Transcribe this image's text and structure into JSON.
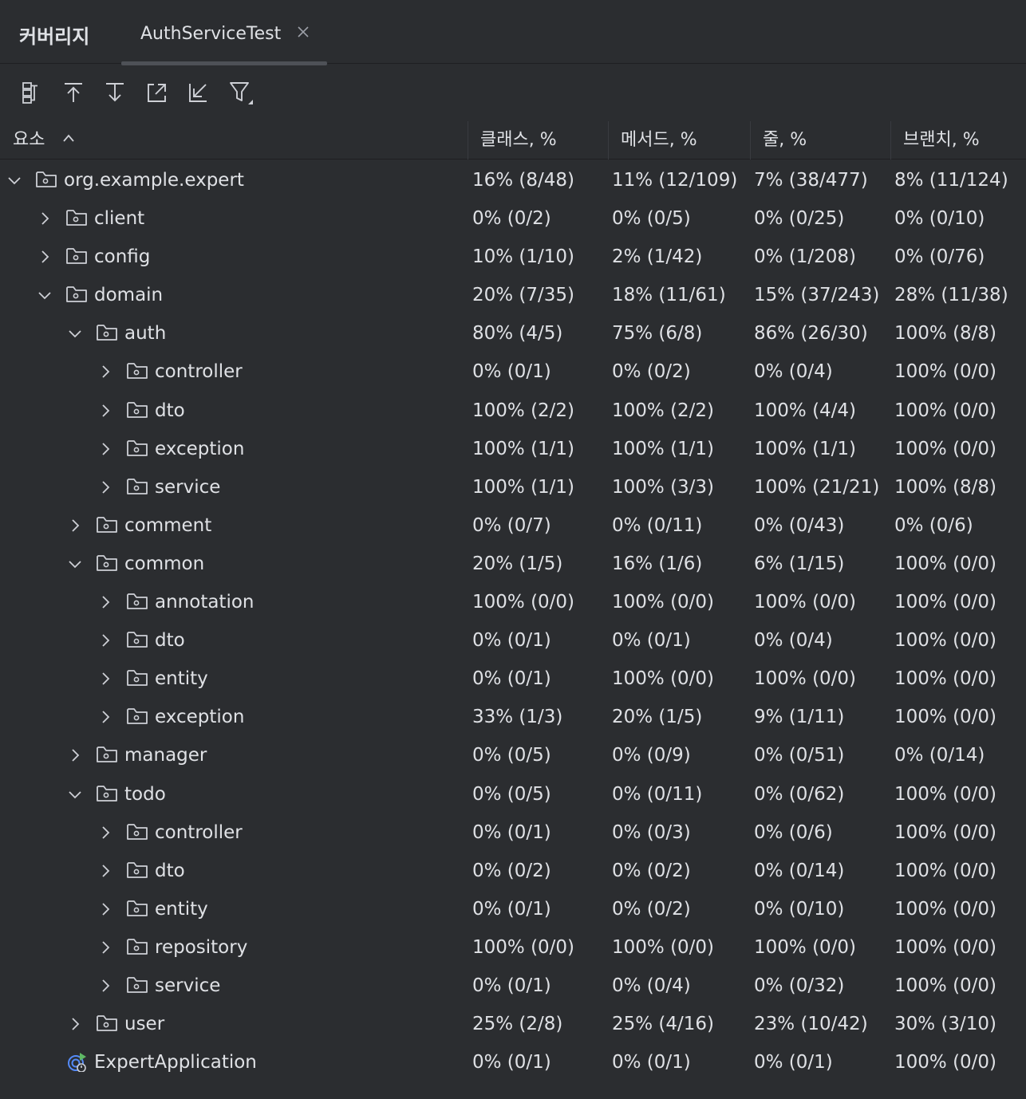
{
  "panel": {
    "title": "커버리지",
    "tab_label": "AuthServiceTest",
    "close_glyph": "×"
  },
  "toolbar": {
    "buttons": [
      "flatten-packages-icon",
      "navigate-up-icon",
      "navigate-down-icon",
      "export-icon",
      "import-icon",
      "filter-icon"
    ]
  },
  "columns": {
    "element": "요소",
    "class": "클래스, %",
    "method": "메서드, %",
    "line": "줄, %",
    "branch": "브랜치, %"
  },
  "colors": {
    "background": "#2b2d30",
    "text": "#dfe1e5",
    "icon": "#ced0d6",
    "app_icon_blue": "#548af7",
    "app_icon_green": "#5fb865"
  },
  "rows": [
    {
      "name": "org.example.expert",
      "level": 0,
      "state": "expanded",
      "icon": "package-folder-icon",
      "cls": "16% (8/48)",
      "met": "11% (12/109)",
      "line": "7% (38/477)",
      "br": "8% (11/124)"
    },
    {
      "name": "client",
      "level": 1,
      "state": "collapsed",
      "icon": "package-folder-icon",
      "cls": "0% (0/2)",
      "met": "0% (0/5)",
      "line": "0% (0/25)",
      "br": "0% (0/10)"
    },
    {
      "name": "config",
      "level": 1,
      "state": "collapsed",
      "icon": "package-folder-icon",
      "cls": "10% (1/10)",
      "met": "2% (1/42)",
      "line": "0% (1/208)",
      "br": "0% (0/76)"
    },
    {
      "name": "domain",
      "level": 1,
      "state": "expanded",
      "icon": "package-folder-icon",
      "cls": "20% (7/35)",
      "met": "18% (11/61)",
      "line": "15% (37/243)",
      "br": "28% (11/38)"
    },
    {
      "name": "auth",
      "level": 2,
      "state": "expanded",
      "icon": "package-folder-icon",
      "cls": "80% (4/5)",
      "met": "75% (6/8)",
      "line": "86% (26/30)",
      "br": "100% (8/8)"
    },
    {
      "name": "controller",
      "level": 3,
      "state": "collapsed",
      "icon": "package-folder-icon",
      "cls": "0% (0/1)",
      "met": "0% (0/2)",
      "line": "0% (0/4)",
      "br": "100% (0/0)"
    },
    {
      "name": "dto",
      "level": 3,
      "state": "collapsed",
      "icon": "package-folder-icon",
      "cls": "100% (2/2)",
      "met": "100% (2/2)",
      "line": "100% (4/4)",
      "br": "100% (0/0)"
    },
    {
      "name": "exception",
      "level": 3,
      "state": "collapsed",
      "icon": "package-folder-icon",
      "cls": "100% (1/1)",
      "met": "100% (1/1)",
      "line": "100% (1/1)",
      "br": "100% (0/0)"
    },
    {
      "name": "service",
      "level": 3,
      "state": "collapsed",
      "icon": "package-folder-icon",
      "cls": "100% (1/1)",
      "met": "100% (3/3)",
      "line": "100% (21/21)",
      "br": "100% (8/8)"
    },
    {
      "name": "comment",
      "level": 2,
      "state": "collapsed",
      "icon": "package-folder-icon",
      "cls": "0% (0/7)",
      "met": "0% (0/11)",
      "line": "0% (0/43)",
      "br": "0% (0/6)"
    },
    {
      "name": "common",
      "level": 2,
      "state": "expanded",
      "icon": "package-folder-icon",
      "cls": "20% (1/5)",
      "met": "16% (1/6)",
      "line": "6% (1/15)",
      "br": "100% (0/0)"
    },
    {
      "name": "annotation",
      "level": 3,
      "state": "collapsed",
      "icon": "package-folder-icon",
      "cls": "100% (0/0)",
      "met": "100% (0/0)",
      "line": "100% (0/0)",
      "br": "100% (0/0)"
    },
    {
      "name": "dto",
      "level": 3,
      "state": "collapsed",
      "icon": "package-folder-icon",
      "cls": "0% (0/1)",
      "met": "0% (0/1)",
      "line": "0% (0/4)",
      "br": "100% (0/0)"
    },
    {
      "name": "entity",
      "level": 3,
      "state": "collapsed",
      "icon": "package-folder-icon",
      "cls": "0% (0/1)",
      "met": "100% (0/0)",
      "line": "100% (0/0)",
      "br": "100% (0/0)"
    },
    {
      "name": "exception",
      "level": 3,
      "state": "collapsed",
      "icon": "package-folder-icon",
      "cls": "33% (1/3)",
      "met": "20% (1/5)",
      "line": "9% (1/11)",
      "br": "100% (0/0)"
    },
    {
      "name": "manager",
      "level": 2,
      "state": "collapsed",
      "icon": "package-folder-icon",
      "cls": "0% (0/5)",
      "met": "0% (0/9)",
      "line": "0% (0/51)",
      "br": "0% (0/14)"
    },
    {
      "name": "todo",
      "level": 2,
      "state": "expanded",
      "icon": "package-folder-icon",
      "cls": "0% (0/5)",
      "met": "0% (0/11)",
      "line": "0% (0/62)",
      "br": "100% (0/0)"
    },
    {
      "name": "controller",
      "level": 3,
      "state": "collapsed",
      "icon": "package-folder-icon",
      "cls": "0% (0/1)",
      "met": "0% (0/3)",
      "line": "0% (0/6)",
      "br": "100% (0/0)"
    },
    {
      "name": "dto",
      "level": 3,
      "state": "collapsed",
      "icon": "package-folder-icon",
      "cls": "0% (0/2)",
      "met": "0% (0/2)",
      "line": "0% (0/14)",
      "br": "100% (0/0)"
    },
    {
      "name": "entity",
      "level": 3,
      "state": "collapsed",
      "icon": "package-folder-icon",
      "cls": "0% (0/1)",
      "met": "0% (0/2)",
      "line": "0% (0/10)",
      "br": "100% (0/0)"
    },
    {
      "name": "repository",
      "level": 3,
      "state": "collapsed",
      "icon": "package-folder-icon",
      "cls": "100% (0/0)",
      "met": "100% (0/0)",
      "line": "100% (0/0)",
      "br": "100% (0/0)"
    },
    {
      "name": "service",
      "level": 3,
      "state": "collapsed",
      "icon": "package-folder-icon",
      "cls": "0% (0/1)",
      "met": "0% (0/4)",
      "line": "0% (0/32)",
      "br": "100% (0/0)"
    },
    {
      "name": "user",
      "level": 2,
      "state": "collapsed",
      "icon": "package-folder-icon",
      "cls": "25% (2/8)",
      "met": "25% (4/16)",
      "line": "23% (10/42)",
      "br": "30% (3/10)"
    },
    {
      "name": "ExpertApplication",
      "level": 1,
      "state": "leaf",
      "icon": "spring-boot-app-icon",
      "cls": "0% (0/1)",
      "met": "0% (0/1)",
      "line": "0% (0/1)",
      "br": "100% (0/0)"
    }
  ]
}
